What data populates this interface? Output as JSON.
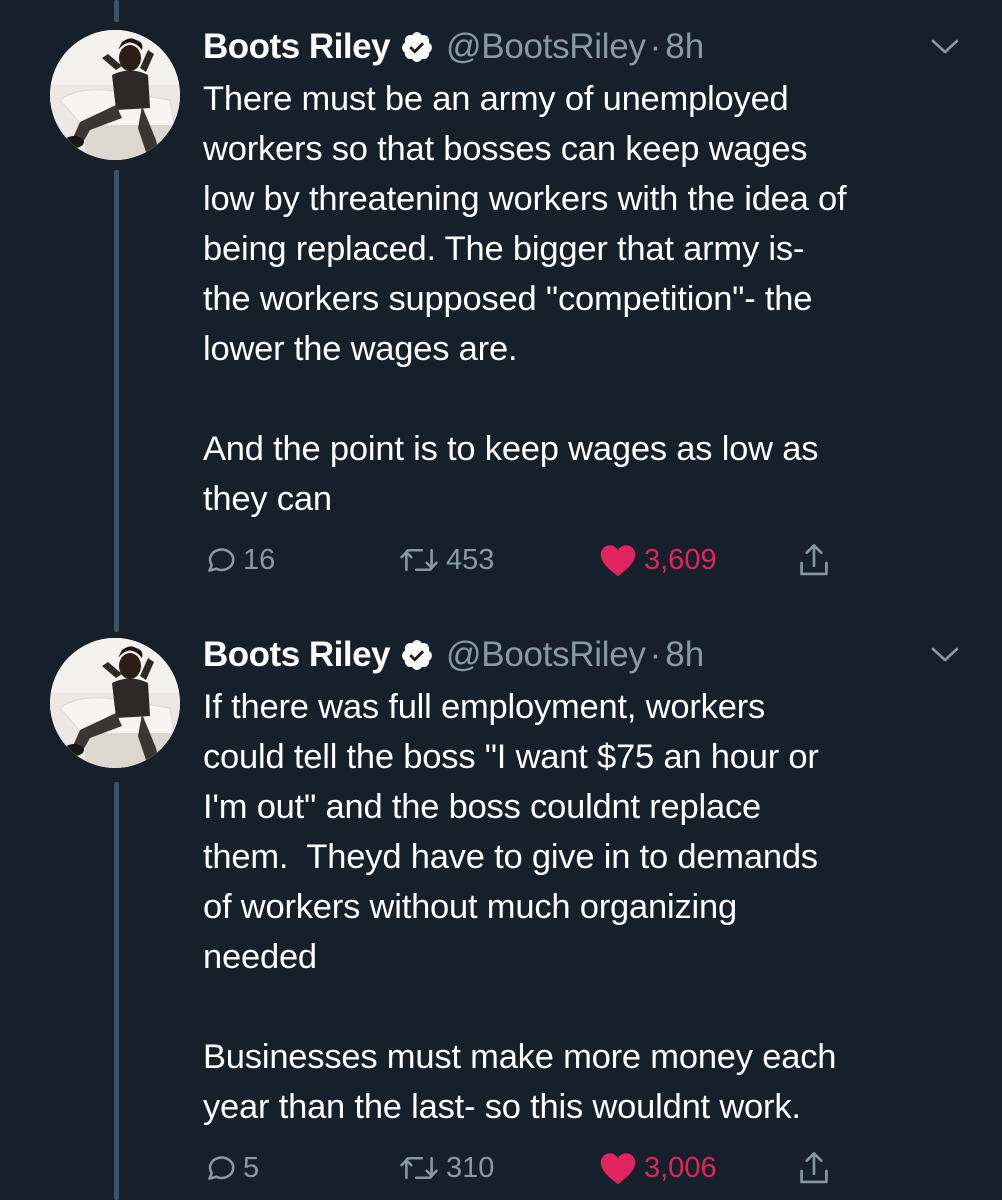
{
  "tweets": [
    {
      "display_name": "Boots Riley",
      "handle": "@BootsRiley",
      "separator": "·",
      "time": "8h",
      "text": "There must be an army of unemployed\nworkers so that bosses can keep wages\nlow by threatening workers with the idea of\nbeing replaced. The bigger that army is-\nthe workers supposed \"competition\"- the\nlower the wages are.\n\nAnd the point is to keep wages as low as\nthey can",
      "replies": "16",
      "retweets": "453",
      "likes": "3,609",
      "liked": true
    },
    {
      "display_name": "Boots Riley",
      "handle": "@BootsRiley",
      "separator": "·",
      "time": "8h",
      "text": "If there was full employment, workers\ncould tell the boss \"I want $75 an hour or\nI'm out\" and the boss couldnt replace\nthem.  Theyd have to give in to demands\nof workers without much organizing\nneeded\n\nBusinesses must make more money each\nyear than the last- so this wouldnt work.",
      "replies": "5",
      "retweets": "310",
      "likes": "3,006",
      "liked": true
    }
  ],
  "colors": {
    "background": "#15202b",
    "secondary_text": "#8899a6",
    "like": "#e0245e",
    "verified_badge": "#ffffff",
    "thread_line": "#3d5466"
  },
  "icons": {
    "verified": "verified-badge-icon",
    "menu": "chevron-down-icon",
    "reply": "reply-icon",
    "retweet": "retweet-icon",
    "like": "heart-icon",
    "share": "share-icon"
  }
}
